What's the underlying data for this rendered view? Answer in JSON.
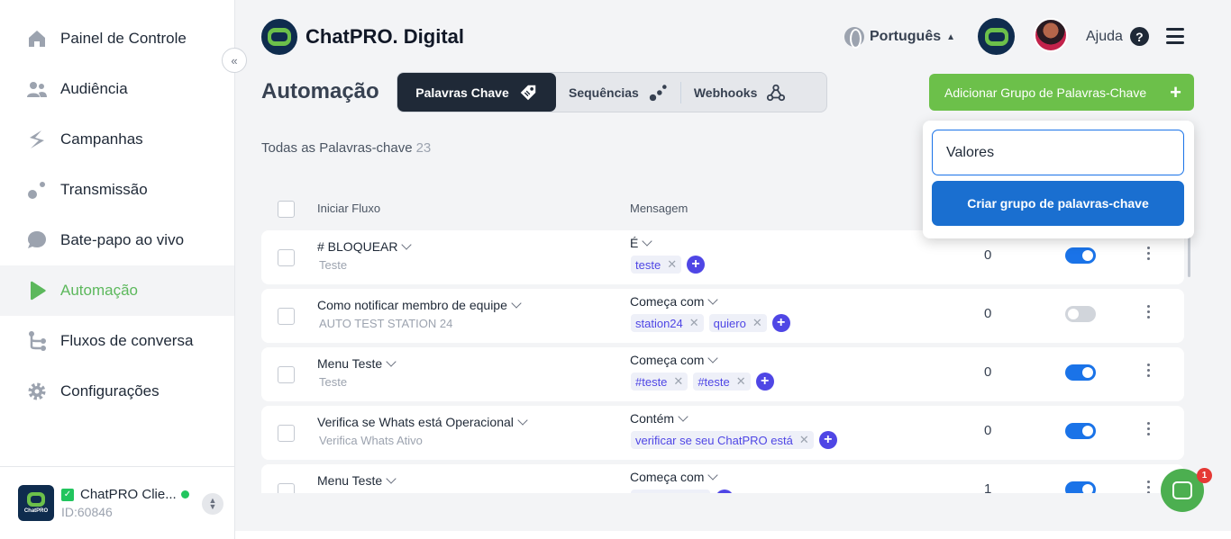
{
  "sidebar": {
    "items": [
      {
        "label": "Painel de Controle",
        "icon": "home-icon"
      },
      {
        "label": "Audiência",
        "icon": "users-icon"
      },
      {
        "label": "Campanhas",
        "icon": "campaign-icon"
      },
      {
        "label": "Transmissão",
        "icon": "broadcast-icon"
      },
      {
        "label": "Bate-papo ao vivo",
        "icon": "chat-bubble-icon"
      },
      {
        "label": "Automação",
        "icon": "play-icon",
        "active": true
      },
      {
        "label": "Fluxos de conversa",
        "icon": "flow-icon"
      },
      {
        "label": "Configurações",
        "icon": "gear-icon"
      }
    ],
    "collapse_icon": "«",
    "account": {
      "name": "ChatPRO Clie...",
      "id": "ID:60846",
      "logo_text": "ChatPRO"
    }
  },
  "header": {
    "brand": "ChatPRO. Digital",
    "language": "Português",
    "help": "Ajuda",
    "help_icon": "?"
  },
  "page": {
    "title": "Automação",
    "tabs": [
      {
        "label": "Palavras Chave",
        "icon": "tag-icon",
        "active": true
      },
      {
        "label": "Sequências",
        "icon": "sequence-icon"
      },
      {
        "label": "Webhooks",
        "icon": "webhook-icon"
      }
    ],
    "add_button": "Adicionar Grupo de Palavras-Chave",
    "add_plus": "+",
    "count_label": "Todas as Palavras-chave",
    "count": "23"
  },
  "popover": {
    "input_value": "Valores",
    "button": "Criar grupo de palavras-chave"
  },
  "table": {
    "headers": {
      "flow": "Iniciar Fluxo",
      "message": "Mensagem"
    },
    "rows": [
      {
        "name": "# BLOQUEAR",
        "sub": "Teste",
        "cond": "É",
        "tags": [
          "teste"
        ],
        "count": "0",
        "enabled": true
      },
      {
        "name": "Como notificar membro de equipe",
        "sub": "AUTO TEST STATION 24",
        "cond": "Começa com",
        "tags": [
          "station24",
          "quiero"
        ],
        "count": "0",
        "enabled": false
      },
      {
        "name": "Menu Teste",
        "sub": "Teste",
        "cond": "Começa com",
        "tags": [
          "#teste",
          "#teste"
        ],
        "count": "0",
        "enabled": true
      },
      {
        "name": "Verifica se Whats está Operacional",
        "sub": "Verifica Whats Ativo",
        "cond": "Contém",
        "tags": [
          "verificar se seu ChatPRO está"
        ],
        "count": "0",
        "enabled": true
      },
      {
        "name": "Menu Teste",
        "sub": "",
        "cond": "Começa com",
        "tags": [],
        "count": "1",
        "enabled": true
      }
    ]
  },
  "chat_widget": {
    "badge": "1"
  }
}
